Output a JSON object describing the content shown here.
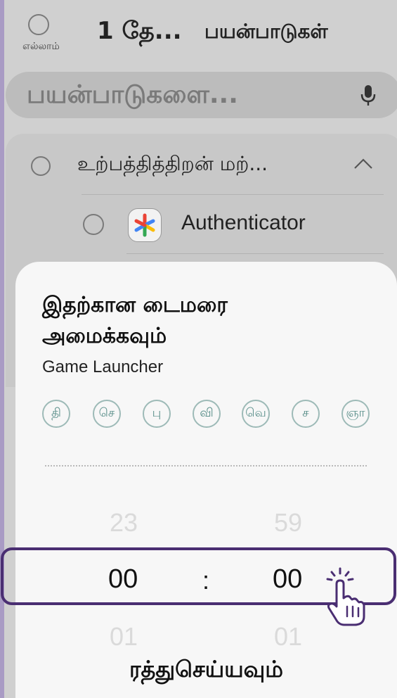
{
  "header": {
    "select_all_label": "எல்லாம்",
    "selected_count": "1 தே...",
    "title": "பயன்பாடுகள்"
  },
  "search": {
    "placeholder": "பயன்பாடுகளை..."
  },
  "category": {
    "label": "உற்பத்தித்திறன் மற்...",
    "apps": [
      {
        "name": "Authenticator"
      }
    ]
  },
  "sheet": {
    "title": "இதற்கான டைமரை அமைக்கவும்",
    "app_name": "Game Launcher",
    "days": [
      "தி",
      "செ",
      "பு",
      "வி",
      "வெ",
      "ச",
      "ஞா"
    ],
    "hours": {
      "prev": "23",
      "current": "00",
      "next": "01"
    },
    "minutes": {
      "prev": "59",
      "current": "00",
      "next": "01"
    },
    "separator": ":",
    "cancel_label": "ரத்துசெய்யவும்"
  },
  "colors": {
    "highlight": "#4a2e72",
    "day_outline": "#9dbab7"
  }
}
